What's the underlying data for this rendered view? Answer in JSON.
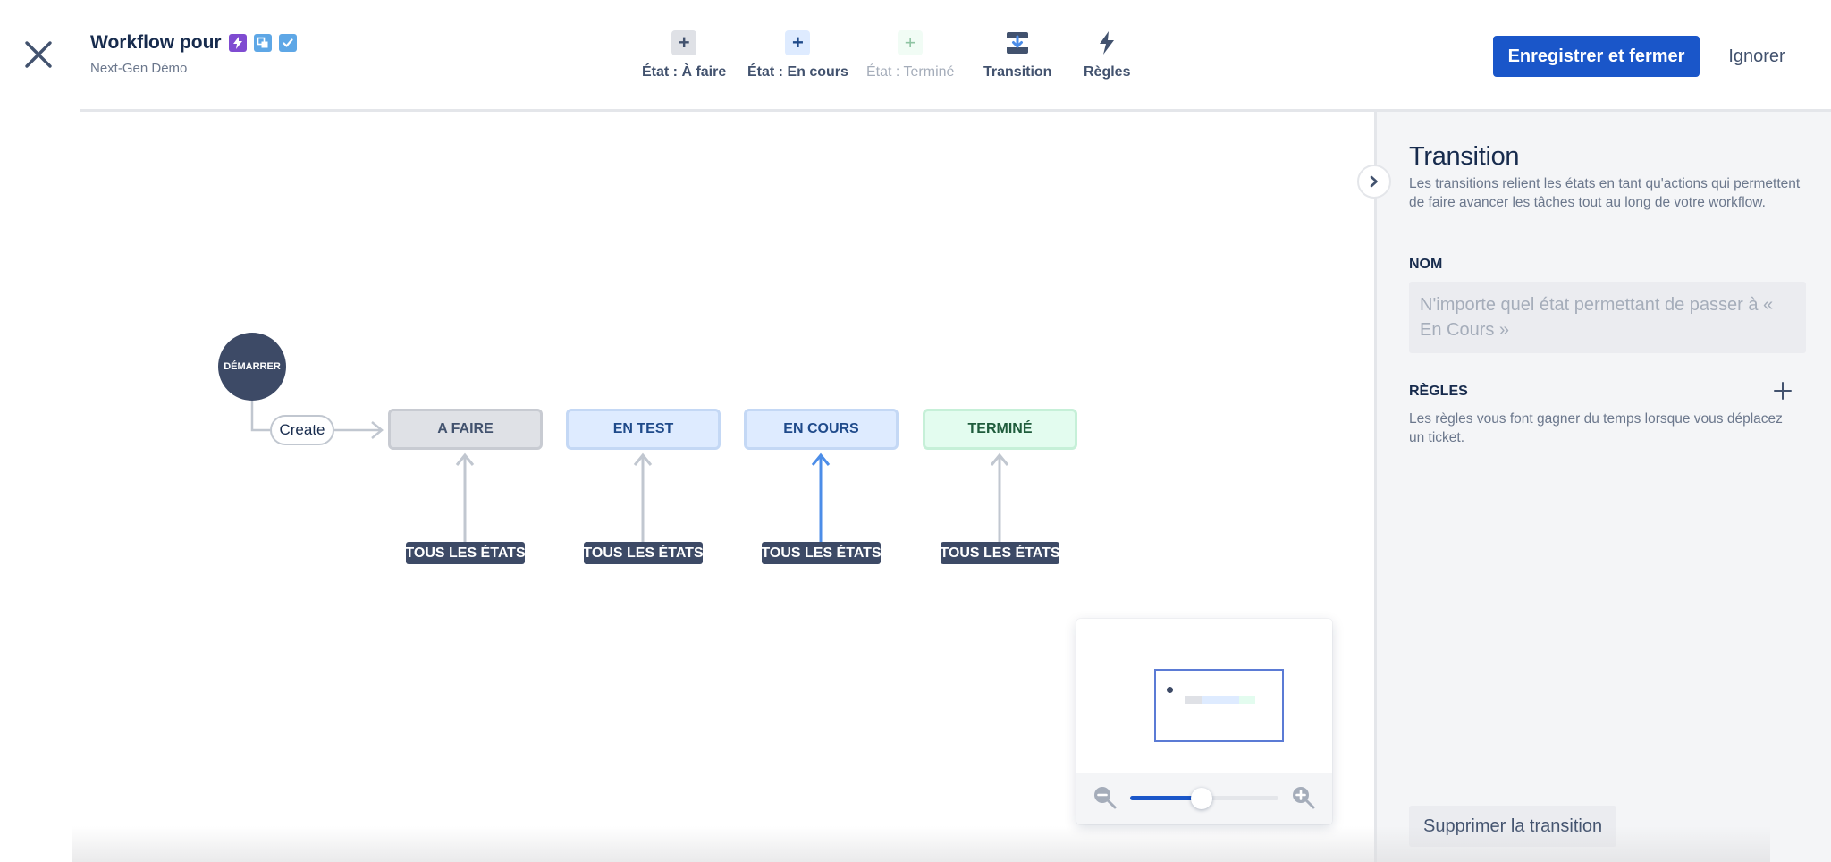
{
  "header": {
    "title": "Workflow pour",
    "subtitle": "Next-Gen Démo",
    "issue_type_icons": [
      {
        "name": "lightning-icon",
        "color": "#7f4bd1"
      },
      {
        "name": "subtask-icon",
        "color": "#5ea7e6"
      },
      {
        "name": "checkbox-icon",
        "color": "#5ea7e6"
      }
    ],
    "close_icon": "close-icon"
  },
  "toolbar": {
    "items": [
      {
        "label": "État : À faire",
        "icon": "plus-icon",
        "enabled": true
      },
      {
        "label": "État : En cours",
        "icon": "plus-icon",
        "enabled": true
      },
      {
        "label": "État : Terminé",
        "icon": "plus-icon",
        "enabled": false
      },
      {
        "label": "Transition",
        "icon": "transition-icon",
        "enabled": true
      },
      {
        "label": "Règles",
        "icon": "lightning-icon",
        "enabled": true
      }
    ],
    "save_label": "Enregistrer et fermer",
    "ignore_label": "Ignorer"
  },
  "canvas": {
    "start_node": "DÉMARRER",
    "create_transition": "Create",
    "statuses": [
      {
        "label": "A FAIRE",
        "category": "todo"
      },
      {
        "label": "EN TEST",
        "category": "inprogress"
      },
      {
        "label": "EN COURS",
        "category": "inprogress"
      },
      {
        "label": "TERMINÉ",
        "category": "done"
      }
    ],
    "all_states_label": "TOUS LES ÉTATS",
    "selected_transition_target": "EN COURS",
    "colors": {
      "todo_bg": "#dfe1e6",
      "inprogress_bg": "#deebff",
      "done_bg": "#e3fcef",
      "selected_edge": "#4c8de8",
      "edge": "#c1c7d0"
    }
  },
  "minimap": {
    "zoom_level": 0.48,
    "zoom_out_icon": "zoom-out-icon",
    "zoom_in_icon": "zoom-in-icon"
  },
  "panel": {
    "title": "Transition",
    "description": "Les transitions relient les états en tant qu'actions qui permettent de faire avancer les tâches tout au long de votre workflow.",
    "name_label": "NOM",
    "name_value": "",
    "name_placeholder": "N'importe quel état permettant de passer à « En Cours »",
    "rules_label": "RÈGLES",
    "rules_description": "Les règles vous font gagner du temps lorsque vous déplacez un ticket.",
    "delete_label": "Supprimer la transition"
  },
  "colors": {
    "primary": "#1a56c9",
    "text": "#172b4d",
    "subtle_text": "#6b778c",
    "panel_bg": "#f4f5f7"
  }
}
